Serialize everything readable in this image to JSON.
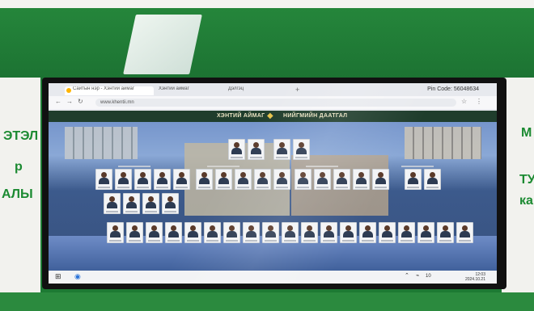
{
  "browser": {
    "tab_active": "Сайтын нэр - Хэнтий аймаг",
    "tab_2": "Хэнтий аймаг",
    "tab_3": "Дэлгэц",
    "new_tab": "+",
    "pin_code": "Pin Code: 56048634",
    "url": "www.khentii.mn"
  },
  "site": {
    "left_title": "ХЭНТИЙ АЙМАГ",
    "right_title": "НИЙГМИЙН ДААТГАЛ"
  },
  "taskbar": {
    "time": "12:03",
    "date": "2024.10.21",
    "num": "10"
  },
  "wall": {
    "left_words": [
      "ЭТЭЛ",
      "р",
      "АЛЫ"
    ],
    "right_words": [
      "М",
      "ТУ",
      "кан"
    ]
  }
}
